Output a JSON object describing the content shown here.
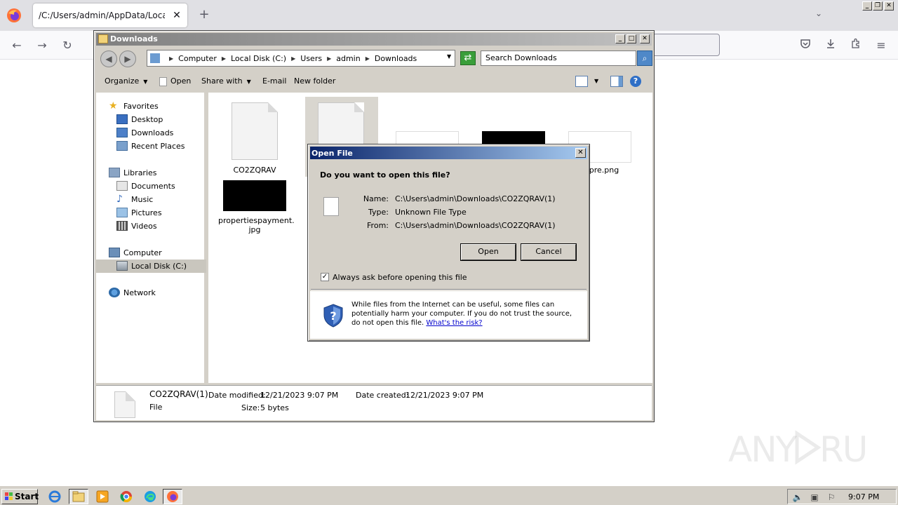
{
  "browser": {
    "tab_title": "/C:/Users/admin/AppData/Local/Microsoft/Windows/INetCache",
    "tab_close": "✕",
    "new_tab": "+",
    "list_tabs": "⌄"
  },
  "explorer": {
    "title": "Downloads",
    "breadcrumb": [
      "Computer",
      "Local Disk (C:)",
      "Users",
      "admin",
      "Downloads"
    ],
    "search_placeholder": "Search Downloads",
    "toolbar": {
      "organize": "Organize",
      "open": "Open",
      "share_with": "Share with",
      "email": "E-mail",
      "new_folder": "New folder"
    },
    "nav": {
      "favorites": "Favorites",
      "desktop": "Desktop",
      "downloads": "Downloads",
      "recent_places": "Recent Places",
      "libraries": "Libraries",
      "documents": "Documents",
      "music": "Music",
      "pictures": "Pictures",
      "videos": "Videos",
      "computer": "Computer",
      "local_disk": "Local Disk (C:)",
      "network": "Network"
    },
    "files": {
      "file1": "CO2ZQRAV",
      "file_partial": "epre.png",
      "file_payment_line1": "propertiespayment.",
      "file_payment_line2": "jpg"
    },
    "details": {
      "name": "CO2ZQRAV(1)",
      "type": "File",
      "date_modified_label": "Date modified:",
      "date_modified": "12/21/2023 9:07 PM",
      "date_created_label": "Date created:",
      "date_created": "12/21/2023 9:07 PM",
      "size_label": "Size:",
      "size": "5 bytes"
    }
  },
  "dialog": {
    "title": "Open File",
    "question": "Do you want to open this file?",
    "name_label": "Name:",
    "name_value": "C:\\Users\\admin\\Downloads\\CO2ZQRAV(1)",
    "type_label": "Type:",
    "type_value": "Unknown File Type",
    "from_label": "From:",
    "from_value": "C:\\Users\\admin\\Downloads\\CO2ZQRAV(1)",
    "open_button": "Open",
    "cancel_button": "Cancel",
    "always_ask_label": "Always ask before opening this file",
    "always_ask_checked": true,
    "warning_text": "While files from the Internet can be useful, some files can potentially harm your computer. If you do not trust the source, do not open this file. ",
    "risk_link": "What's the risk?"
  },
  "taskbar": {
    "start": "Start",
    "time": "9:07 PM"
  },
  "watermark": "ANY RUN"
}
